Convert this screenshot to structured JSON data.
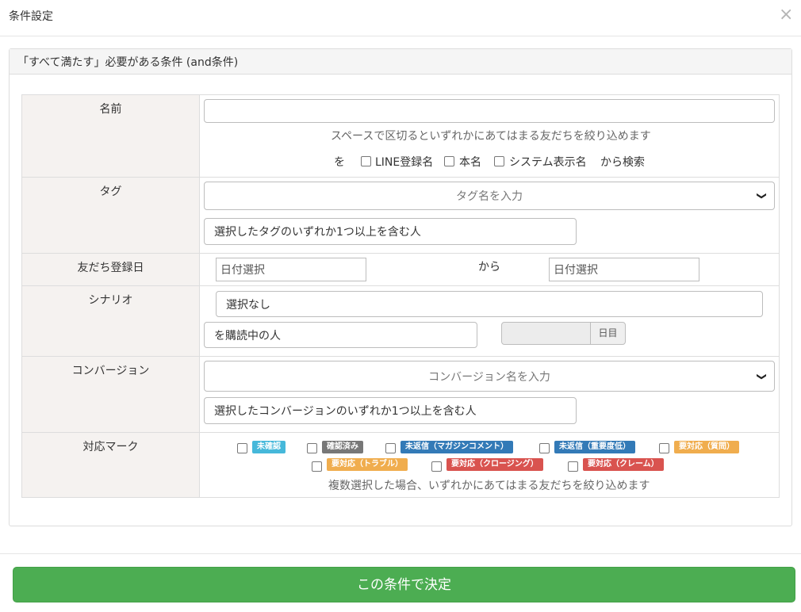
{
  "modal": {
    "title": "条件設定",
    "close_icon": "×"
  },
  "panel": {
    "title": "「すべて満たす」必要がある条件 (and条件)"
  },
  "conditions": {
    "name": {
      "label": "名前",
      "value": "",
      "hint": "スペースで区切るといずれかにあてはまる友だちを絞り込めます",
      "prefix": "を",
      "options": [
        "LINE登録名",
        "本名",
        "システム表示名"
      ],
      "suffix": "から検索"
    },
    "tag": {
      "label": "タグ",
      "placeholder": "タグ名を入力",
      "chevron": "❯",
      "mode": "選択したタグのいずれか1つ以上を含む人"
    },
    "friend_date": {
      "label": "友だち登録日",
      "from_placeholder": "日付選択",
      "between": "から",
      "to_placeholder": "日付選択"
    },
    "scenario": {
      "label": "シナリオ",
      "value": "選択なし",
      "mode": "を購読中の人",
      "days_value": "",
      "days_unit": "日目"
    },
    "conversion": {
      "label": "コンバージョン",
      "placeholder": "コンバージョン名を入力",
      "chevron": "❯",
      "mode": "選択したコンバージョンのいずれか1つ以上を含む人"
    },
    "marks": {
      "label": "対応マーク",
      "items": [
        {
          "label": "未確認",
          "color": "#46b8da"
        },
        {
          "label": "確認済み",
          "color": "#777777"
        },
        {
          "label": "未返信（マガジンコメント）",
          "color": "#337ab7"
        },
        {
          "label": "未返信（重要度低）",
          "color": "#337ab7"
        },
        {
          "label": "要対応（質問）",
          "color": "#f0ad4e"
        },
        {
          "label": "要対応（トラブル）",
          "color": "#f0ad4e"
        },
        {
          "label": "要対応（クロージング）",
          "color": "#d9534f"
        },
        {
          "label": "要対応（クレーム）",
          "color": "#d9534f"
        }
      ],
      "hint": "複数選択した場合、いずれかにあてはまる友だちを絞り込めます"
    }
  },
  "footer": {
    "submit_label": "この条件で決定",
    "submit_color": "#4cad52"
  }
}
